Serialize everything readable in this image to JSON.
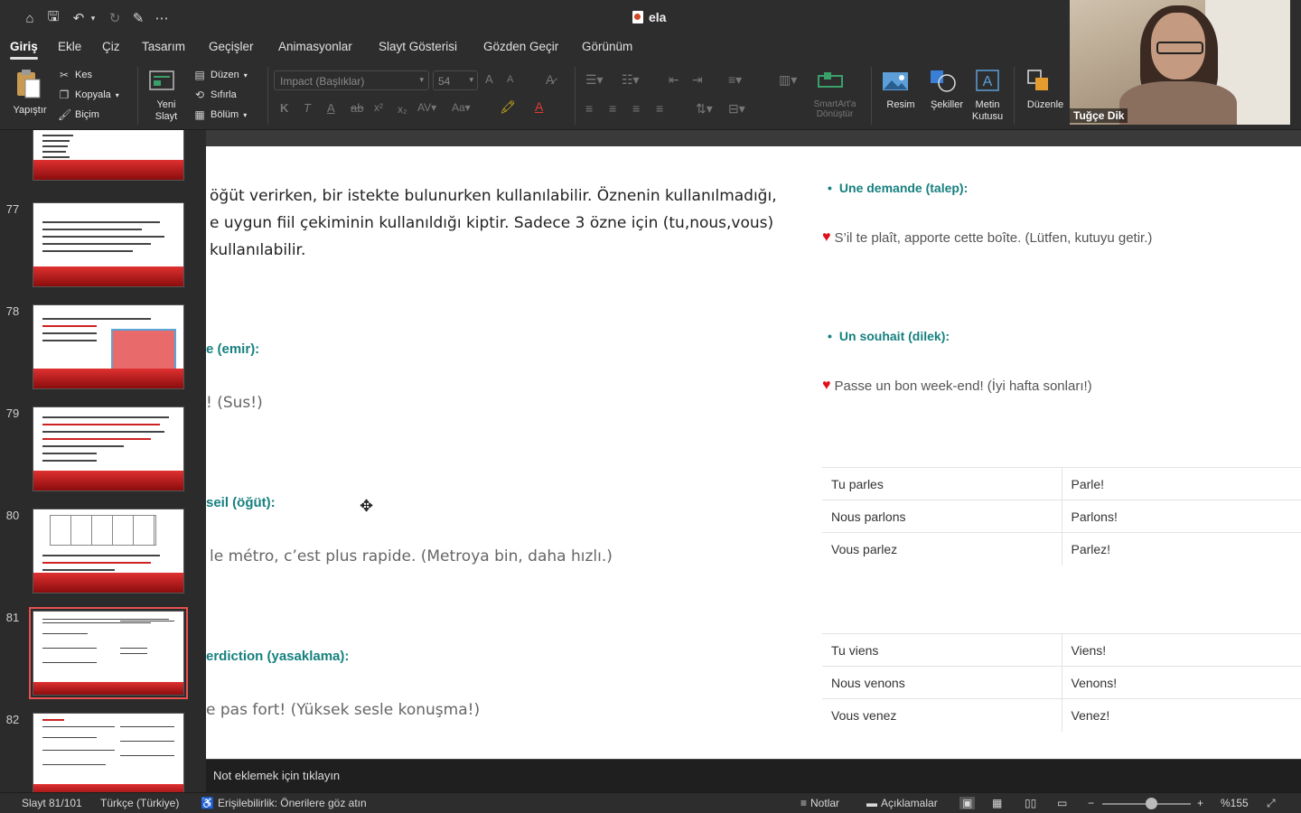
{
  "titlebar": {
    "doc_title": "ela",
    "quick_access": [
      "home-icon",
      "save-icon",
      "undo-icon",
      "redo-icon",
      "customize-icon",
      "more-icon"
    ]
  },
  "tabs": [
    "Giriş",
    "Ekle",
    "Çiz",
    "Tasarım",
    "Geçişler",
    "Animasyonlar",
    "Slayt Gösterisi",
    "Gözden Geçir",
    "Görünüm"
  ],
  "ribbon": {
    "paste": "Yapıştır",
    "cut": "Kes",
    "copy": "Kopyala",
    "format": "Biçim",
    "new_slide_line1": "Yeni",
    "new_slide_line2": "Slayt",
    "layout": "Düzen",
    "reset": "Sıfırla",
    "section": "Bölüm",
    "font_name": "Impact (Başlıklar)",
    "font_size": "54",
    "smartart_line1": "SmartArt'a",
    "smartart_line2": "Dönüştür",
    "picture": "Resim",
    "shapes": "Şekiller",
    "textbox_line1": "Metin",
    "textbox_line2": "Kutusu",
    "arrange": "Düzenle"
  },
  "video": {
    "participant_name": "Tuğçe Dik"
  },
  "thumbnails": [
    {
      "num": "",
      "selected": false
    },
    {
      "num": "77",
      "selected": false
    },
    {
      "num": "78",
      "selected": false
    },
    {
      "num": "79",
      "selected": false
    },
    {
      "num": "80",
      "selected": false
    },
    {
      "num": "81",
      "selected": true
    },
    {
      "num": "82",
      "selected": false
    }
  ],
  "slide": {
    "intro_line1": "öğüt verirken, bir istekte bulunurken kullanılabilir. Öznenin kullanılmadığı,",
    "intro_line2": "e uygun fiil çekiminin kullanıldığı kiptir. Sadece 3 özne için (tu,nous,vous)",
    "intro_line3": "kullanılabilir.",
    "order_head": "e (emir):",
    "order_ex": "! (Sus!)",
    "advice_head": "seil (öğüt):",
    "advice_ex": "le métro, c’est plus rapide. (Metroya bin, daha hızlı.)",
    "forbid_head": "erdiction (yasaklama):",
    "forbid_ex": "e pas fort! (Yüksek sesle konuşma!)",
    "demand_head": "Une demande (talep):",
    "demand_ex": "S’il te plaît, apporte cette boîte. (Lütfen, kutuyu getir.)",
    "wish_head": "Un souhait (dilek):",
    "wish_ex": "Passe un bon week-end! (İyi hafta sonları!)",
    "table_parler": [
      [
        "Tu parles",
        "Parle!"
      ],
      [
        "Nous parlons",
        "Parlons!"
      ],
      [
        "Vous parlez",
        "Parlez!"
      ]
    ],
    "table_venir": [
      [
        "Tu viens",
        "Viens!"
      ],
      [
        "Nous venons",
        "Venons!"
      ],
      [
        "Vous venez",
        "Venez!"
      ]
    ]
  },
  "notes": {
    "placeholder": "Not eklemek için tıklayın"
  },
  "status": {
    "slide_count": "Slayt 81/101",
    "language": "Türkçe (Türkiye)",
    "accessibility": "Erişilebilirlik: Önerilere göz atın",
    "notes_btn": "Notlar",
    "comments_btn": "Açıklamalar",
    "zoom": "%155",
    "zoom_fraction": 0.55
  }
}
